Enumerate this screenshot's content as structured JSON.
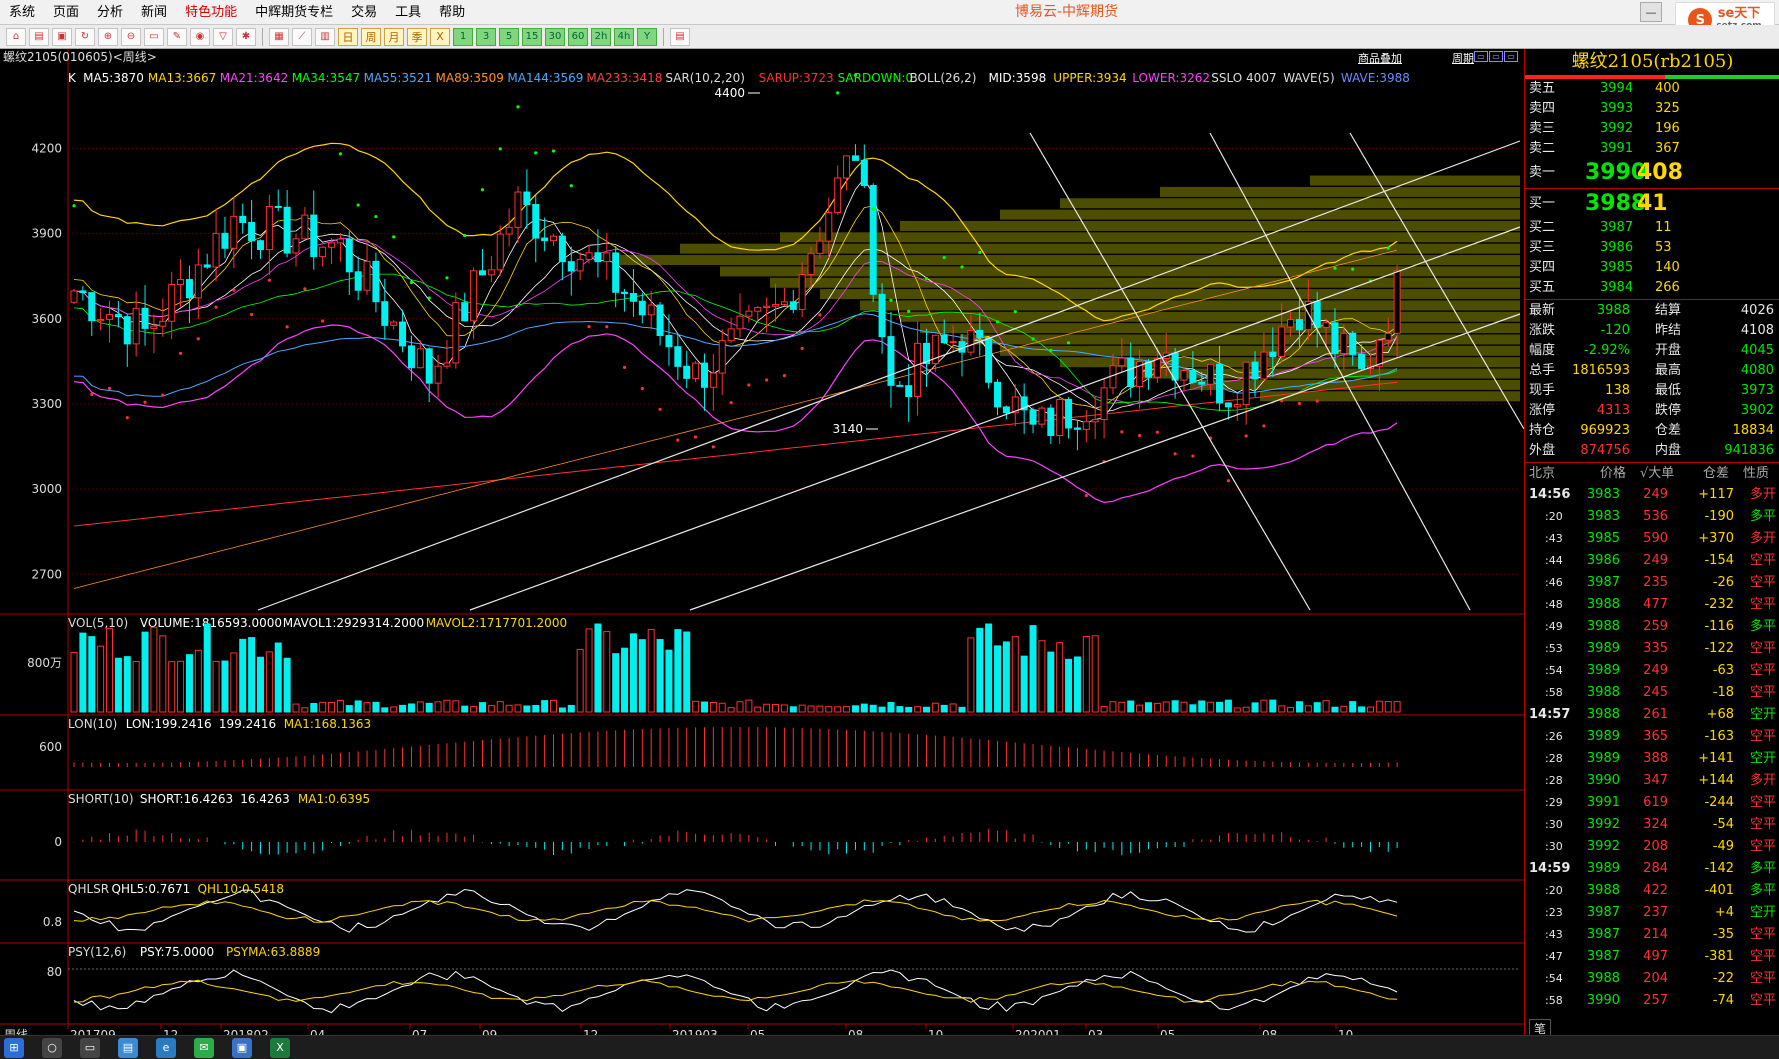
{
  "menu": {
    "items": [
      "系统",
      "页面",
      "分析",
      "新闻",
      "特色功能",
      "中辉期货专栏",
      "交易",
      "工具",
      "帮助"
    ],
    "highlight_index": 4,
    "app_title": "博易云-中辉期货"
  },
  "logo": {
    "text": "se天下",
    "sub": "setz.com"
  },
  "toolbar": {
    "numbers": [
      "1",
      "3",
      "5",
      "15",
      "30",
      "60",
      "2h",
      "4h",
      "Y"
    ],
    "periods": [
      "日",
      "周",
      "月",
      "季",
      "X"
    ]
  },
  "chart_header": {
    "instrument": "螺纹2105(010605)<周线>",
    "overlay_label": "商品叠加",
    "period_label": "周期"
  },
  "indicators": {
    "main": [
      {
        "text": "K",
        "color": "#ffffff"
      },
      {
        "text": "MA5:3870",
        "color": "#ffffff"
      },
      {
        "text": "MA13:3667",
        "color": "#ffd700"
      },
      {
        "text": "MA21:3642",
        "color": "#ff40ff"
      },
      {
        "text": "MA34:3547",
        "color": "#00ff00"
      },
      {
        "text": "MA55:3521",
        "color": "#4aa8ff"
      },
      {
        "text": "MA89:3509",
        "color": "#ff9020"
      },
      {
        "text": "MA144:3569",
        "color": "#4aa8ff"
      },
      {
        "text": "MA233:3418",
        "color": "#ff4040"
      },
      {
        "text": "SAR(10,2,20)",
        "color": "#dddddd"
      },
      {
        "text": "SARUP:3723",
        "color": "#ff3030"
      },
      {
        "text": "SARDOWN:0",
        "color": "#00ff00"
      },
      {
        "text": "BOLL(26,2)",
        "color": "#dddddd"
      },
      {
        "text": "MID:3598",
        "color": "#ffffff"
      },
      {
        "text": "UPPER:3934",
        "color": "#ffd700"
      },
      {
        "text": "LOWER:3262",
        "color": "#ff40ff"
      },
      {
        "text": "SSLO 4007",
        "color": "#dddddd"
      },
      {
        "text": "WAVE(5)",
        "color": "#dddddd"
      },
      {
        "text": "WAVE:3988",
        "color": "#6a8cff"
      }
    ],
    "vol": [
      {
        "text": "VOL(5,10)",
        "color": "#dddddd"
      },
      {
        "text": "VOLUME:1816593.0000",
        "color": "#ffffff"
      },
      {
        "text": "MAVOL1:2929314.2000",
        "color": "#ffffff"
      },
      {
        "text": "MAVOL2:1717701.2000",
        "color": "#ffd700"
      }
    ],
    "lon": [
      {
        "text": "LON(10)",
        "color": "#dddddd"
      },
      {
        "text": "LON:199.2416",
        "color": "#ffffff"
      },
      {
        "text": "199.2416",
        "color": "#ffffff"
      },
      {
        "text": "MA1:168.1363",
        "color": "#ffd700"
      }
    ],
    "short": [
      {
        "text": "SHORT(10)",
        "color": "#dddddd"
      },
      {
        "text": "SHORT:16.4263",
        "color": "#ffffff"
      },
      {
        "text": "16.4263",
        "color": "#ffffff"
      },
      {
        "text": "MA1:0.6395",
        "color": "#ffd700"
      }
    ],
    "qhlsr": [
      {
        "text": "QHLSR",
        "color": "#dddddd"
      },
      {
        "text": "QHL5:0.7671",
        "color": "#ffffff"
      },
      {
        "text": "QHL10:0.5418",
        "color": "#ffd700"
      }
    ],
    "psy": [
      {
        "text": "PSY(12,6)",
        "color": "#dddddd"
      },
      {
        "text": "PSY:75.0000",
        "color": "#ffffff"
      },
      {
        "text": "PSYMA:63.8889",
        "color": "#ffd700"
      }
    ]
  },
  "axis": {
    "price_ticks": [
      "4200",
      "3900",
      "3600",
      "3300",
      "3000",
      "2700"
    ],
    "vol_tick": "800万",
    "lon_tick": "600",
    "short_tick": "0",
    "qhlsr_tick": "0.8",
    "psy_tick": "80",
    "period_label": "周线",
    "dates": [
      "201709",
      "12",
      "201802",
      "04",
      "07",
      "09",
      "12",
      "201903",
      "05",
      "08",
      "10",
      "202001",
      "03",
      "05",
      "08",
      "10"
    ],
    "annot_high": "4400",
    "annot_low": "3140"
  },
  "chart_data": {
    "type": "candlestick",
    "instrument": "螺纹2105",
    "ylim": [
      2560,
      4480
    ],
    "ohlc": [],
    "seed_note": ""
  },
  "quote": {
    "title": "螺纹2105(rb2105)",
    "asks": [
      {
        "label": "卖五",
        "price": "3994",
        "vol": "400"
      },
      {
        "label": "卖四",
        "price": "3993",
        "vol": "325"
      },
      {
        "label": "卖三",
        "price": "3992",
        "vol": "196"
      },
      {
        "label": "卖二",
        "price": "3991",
        "vol": "367"
      },
      {
        "label": "卖一",
        "price": "3990",
        "vol": "408"
      }
    ],
    "bids": [
      {
        "label": "买一",
        "price": "3988",
        "vol": "41"
      },
      {
        "label": "买二",
        "price": "3987",
        "vol": "11"
      },
      {
        "label": "买三",
        "price": "3986",
        "vol": "53"
      },
      {
        "label": "买四",
        "price": "3985",
        "vol": "140"
      },
      {
        "label": "买五",
        "price": "3984",
        "vol": "266"
      }
    ],
    "stats": [
      {
        "l1": "最新",
        "v1": "3988",
        "c1": "grn",
        "l2": "结算",
        "v2": "4026",
        "c2": "wht"
      },
      {
        "l1": "涨跌",
        "v1": "-120",
        "c1": "grn",
        "l2": "昨结",
        "v2": "4108",
        "c2": "wht"
      },
      {
        "l1": "幅度",
        "v1": "-2.92%",
        "c1": "grn",
        "l2": "开盘",
        "v2": "4045",
        "c2": "grn"
      },
      {
        "l1": "总手",
        "v1": "1816593",
        "c1": "yel",
        "l2": "最高",
        "v2": "4080",
        "c2": "grn"
      },
      {
        "l1": "现手",
        "v1": "138",
        "c1": "yel",
        "l2": "最低",
        "v2": "3973",
        "c2": "grn"
      },
      {
        "l1": "涨停",
        "v1": "4313",
        "c1": "red",
        "l2": "跌停",
        "v2": "3902",
        "c2": "grn"
      },
      {
        "l1": "持仓",
        "v1": "969923",
        "c1": "yel",
        "l2": "仓差",
        "v2": "18834",
        "c2": "yel"
      },
      {
        "l1": "外盘",
        "v1": "874756",
        "c1": "red",
        "l2": "内盘",
        "v2": "941836",
        "c2": "grn"
      }
    ],
    "tick_header": {
      "time": "北京",
      "price": "价格",
      "vol": "√大单",
      "oi": "仓差",
      "nature": "性质"
    },
    "ticks": [
      {
        "t": "14:56",
        "p": "3983",
        "v": "249",
        "o": "+117",
        "n": "多开",
        "nc": "red"
      },
      {
        "t": ":20",
        "p": "3983",
        "v": "536",
        "o": "-190",
        "n": "多平",
        "nc": "grn"
      },
      {
        "t": ":43",
        "p": "3985",
        "v": "590",
        "o": "+370",
        "n": "多开",
        "nc": "red"
      },
      {
        "t": ":44",
        "p": "3986",
        "v": "249",
        "o": "-154",
        "n": "空平",
        "nc": "red"
      },
      {
        "t": ":46",
        "p": "3987",
        "v": "235",
        "o": "-26",
        "n": "空平",
        "nc": "red"
      },
      {
        "t": ":48",
        "p": "3988",
        "v": "477",
        "o": "-232",
        "n": "空平",
        "nc": "red"
      },
      {
        "t": ":49",
        "p": "3988",
        "v": "259",
        "o": "-116",
        "n": "多平",
        "nc": "grn"
      },
      {
        "t": ":53",
        "p": "3989",
        "v": "335",
        "o": "-122",
        "n": "空平",
        "nc": "red"
      },
      {
        "t": ":54",
        "p": "3989",
        "v": "249",
        "o": "-63",
        "n": "空平",
        "nc": "red"
      },
      {
        "t": ":58",
        "p": "3988",
        "v": "245",
        "o": "-18",
        "n": "空平",
        "nc": "red"
      },
      {
        "t": "14:57",
        "p": "3988",
        "v": "261",
        "o": "+68",
        "n": "空开",
        "nc": "grn"
      },
      {
        "t": ":26",
        "p": "3989",
        "v": "365",
        "o": "-163",
        "n": "空平",
        "nc": "red"
      },
      {
        "t": ":28",
        "p": "3989",
        "v": "388",
        "o": "+141",
        "n": "空开",
        "nc": "grn"
      },
      {
        "t": ":28",
        "p": "3990",
        "v": "347",
        "o": "+144",
        "n": "多开",
        "nc": "red"
      },
      {
        "t": ":29",
        "p": "3991",
        "v": "619",
        "o": "-244",
        "n": "空平",
        "nc": "red"
      },
      {
        "t": ":30",
        "p": "3992",
        "v": "324",
        "o": "-54",
        "n": "空平",
        "nc": "red"
      },
      {
        "t": ":30",
        "p": "3992",
        "v": "208",
        "o": "-49",
        "n": "空平",
        "nc": "red"
      },
      {
        "t": "14:59",
        "p": "3989",
        "v": "284",
        "o": "-142",
        "n": "多平",
        "nc": "grn"
      },
      {
        "t": ":20",
        "p": "3988",
        "v": "422",
        "o": "-401",
        "n": "多平",
        "nc": "grn"
      },
      {
        "t": ":23",
        "p": "3987",
        "v": "237",
        "o": "+4",
        "n": "空开",
        "nc": "grn"
      },
      {
        "t": ":43",
        "p": "3987",
        "v": "214",
        "o": "-35",
        "n": "空平",
        "nc": "red"
      },
      {
        "t": ":47",
        "p": "3987",
        "v": "497",
        "o": "-381",
        "n": "空平",
        "nc": "red"
      },
      {
        "t": ":54",
        "p": "3988",
        "v": "204",
        "o": "-22",
        "n": "空平",
        "nc": "red"
      },
      {
        "t": ":58",
        "p": "3990",
        "v": "257",
        "o": "-74",
        "n": "空平",
        "nc": "red"
      }
    ],
    "footer_tab": "笔"
  }
}
